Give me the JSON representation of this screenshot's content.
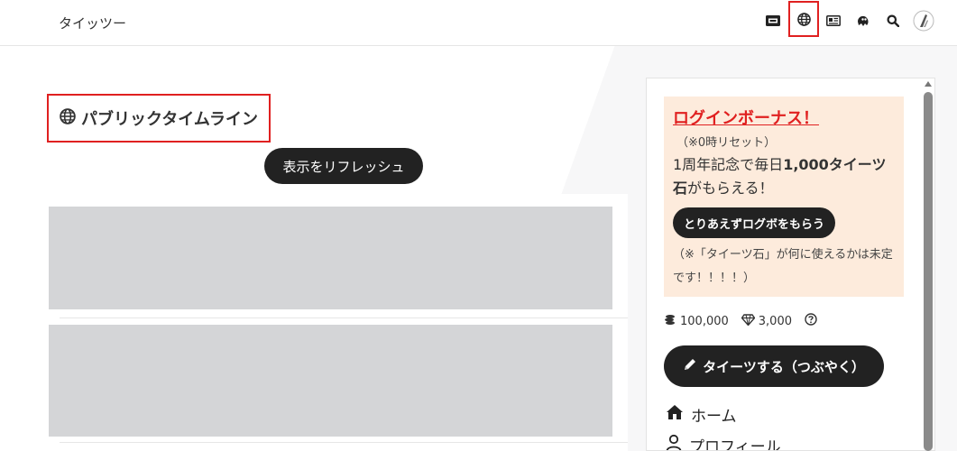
{
  "header": {
    "brand": "タイッツー",
    "icons": [
      "ticket-icon",
      "globe-icon",
      "newspaper-icon",
      "ghost-icon",
      "search-icon",
      "avatar-logo-icon"
    ]
  },
  "main": {
    "title": "パブリックタイムライン",
    "refresh_label": "表示をリフレッシュ"
  },
  "sidebar": {
    "bonus": {
      "title": "ログインボーナス！",
      "reset": "（※0時リセット）",
      "desc_prefix": "1周年記念で毎日",
      "desc_bold": "1,000タイーツ石",
      "desc_suffix": "がもらえる！",
      "button": "とりあえずログボをもらう",
      "note": "（※「タイーツ石」が何に使えるかは未定です！！！！）"
    },
    "coins": "100,000",
    "gems": "3,000",
    "tweet_button": "タイーツする（つぶやく）",
    "nav": [
      {
        "label": "ホーム",
        "icon": "home-icon"
      },
      {
        "label": "プロフィール",
        "icon": "user-icon"
      }
    ]
  },
  "colors": {
    "highlight": "#e02020",
    "bonus_bg": "#fdebdc",
    "button_dark": "#222222",
    "placeholder": "#d4d5d7"
  }
}
